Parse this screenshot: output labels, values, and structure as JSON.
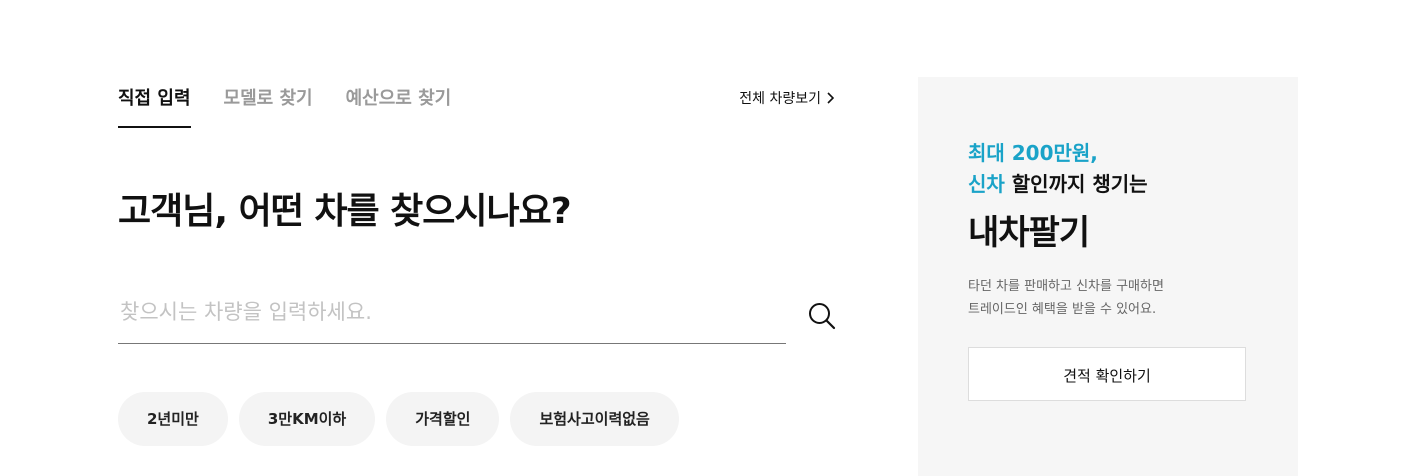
{
  "tabs": [
    {
      "label": "직접 입력",
      "active": true
    },
    {
      "label": "모델로 찾기",
      "active": false
    },
    {
      "label": "예산으로 찾기",
      "active": false
    }
  ],
  "view_all": {
    "label": "전체 차량보기",
    "icon": "chevron-right-icon"
  },
  "headline": "고객님, 어떤 차를 찾으시나요?",
  "search": {
    "value": "",
    "placeholder": "찾으시는 차량을 입력하세요.",
    "icon": "search-icon"
  },
  "chips": [
    {
      "label": "2년미만"
    },
    {
      "label": "3만KM이하"
    },
    {
      "label": "가격할인"
    },
    {
      "label": "보험사고이력없음"
    }
  ],
  "promo": {
    "line1": "최대 200만원,",
    "line2_accent": "신차",
    "line2_rest": " 할인까지 챙기는",
    "title": "내차팔기",
    "desc_line1": "타던 차를 판매하고 신차를 구매하면",
    "desc_line2": "트레이드인 혜택을 받을 수 있어요.",
    "button_label": "견적 확인하기"
  },
  "colors": {
    "accent": "#1aa3c8",
    "text": "#111111",
    "muted": "#9a9a9a",
    "card_bg": "#f6f6f6",
    "chip_bg": "#f4f4f4"
  }
}
